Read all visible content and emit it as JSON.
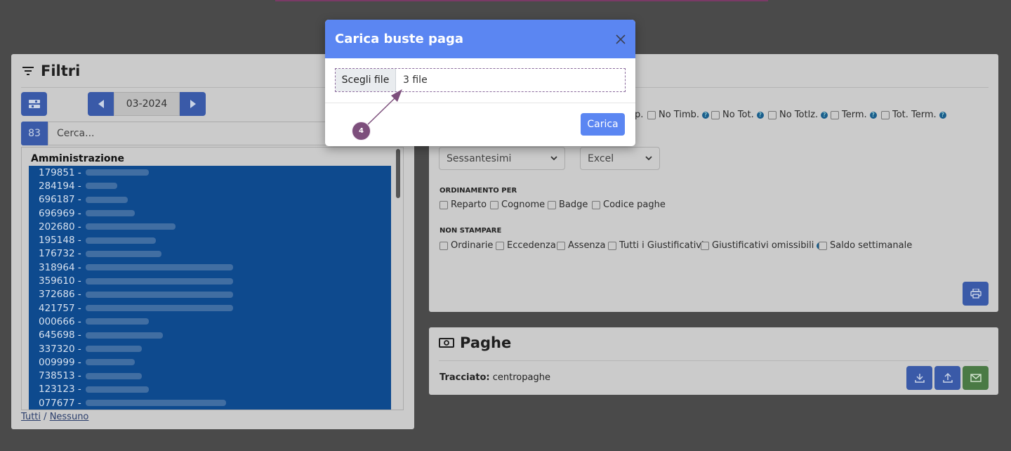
{
  "modal": {
    "title": "Carica buste paga",
    "file_button": "Scegli file",
    "file_value": "3 file",
    "submit": "Carica",
    "step_badge": "4"
  },
  "filters": {
    "title": "Filtri",
    "period": "03-2024",
    "count": "83",
    "search_placeholder": "Cerca...",
    "group": "Amministrazione",
    "employees": [
      "179851 -",
      "284194 -",
      "696187 -",
      "696969 -",
      "202680 -",
      "195148 -",
      "176732 -",
      "318964 -",
      "359610 -",
      "372686 -",
      "421757 -",
      "000666 -",
      "645698 -",
      "337320 -",
      "009999 -",
      "738513 -",
      "123123 -",
      "077677 -"
    ],
    "all_link": "Tutti",
    "separator": "/",
    "none_link": "Nessuno"
  },
  "print_options": {
    "top_options": [
      "No Timb.",
      "No Tot.",
      "No Totlz.",
      "Term.",
      "Tot. Term."
    ],
    "partial_label": "p.",
    "format_select": "Sessantesimi",
    "output_select": "Excel",
    "ordering_label": "ORDINAMENTO PER",
    "ordering": [
      "Reparto",
      "Cognome",
      "Badge",
      "Codice paghe"
    ],
    "exclude_label": "NON STAMPARE",
    "exclude": [
      "Ordinarie",
      "Eccedenza",
      "Assenza",
      "Tutti i Giustificativi",
      "Giustificativi omissibili",
      "Saldo settimanale"
    ],
    "help_symbol": "?"
  },
  "paghe": {
    "title": "Paghe",
    "tracciato_label": "Tracciato:",
    "tracciato_value": "centropaghe"
  }
}
